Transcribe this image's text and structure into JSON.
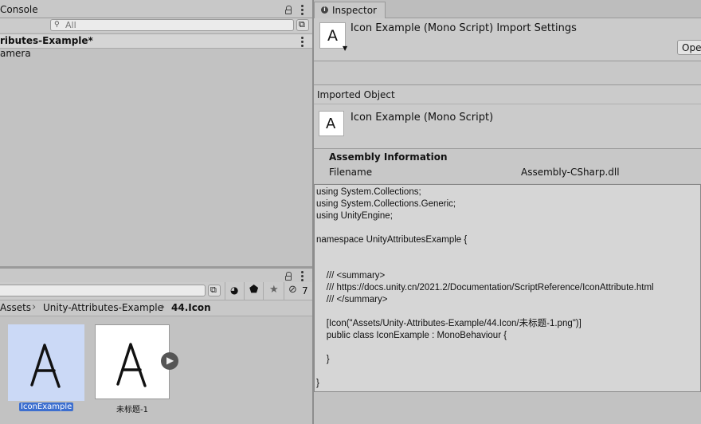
{
  "console": {
    "tab_label": "Console",
    "search_placeholder": "All"
  },
  "hierarchy": {
    "scene_title": "ributes-Example*",
    "items": [
      "amera"
    ]
  },
  "project": {
    "breadcrumb": [
      "Assets",
      "Unity-Attributes-Example",
      "44.Icon"
    ],
    "hidden_count": "7",
    "assets": [
      {
        "name": "IconExample",
        "selected": true
      },
      {
        "name": "未标题-1",
        "selected": false
      }
    ]
  },
  "inspector": {
    "tab_label": "Inspector",
    "header_title": "Icon Example (Mono Script) Import Settings",
    "open_button": "Ope",
    "imported_object_label": "Imported Object",
    "object_title": "Icon Example (Mono Script)",
    "assembly_heading": "Assembly Information",
    "filename_label": "Filename",
    "filename_value": "Assembly-CSharp.dll",
    "code": "using System.Collections;\nusing System.Collections.Generic;\nusing UnityEngine;\n\nnamespace UnityAttributesExample {\n\n\n    /// <summary>\n    /// https://docs.unity.cn/2021.2/Documentation/ScriptReference/IconAttribute.html\n    /// </summary>\n\n    [Icon(\"Assets/Unity-Attributes-Example/44.Icon/未标题-1.png\")]\n    public class IconExample : MonoBehaviour {\n\n    }\n\n}"
  }
}
